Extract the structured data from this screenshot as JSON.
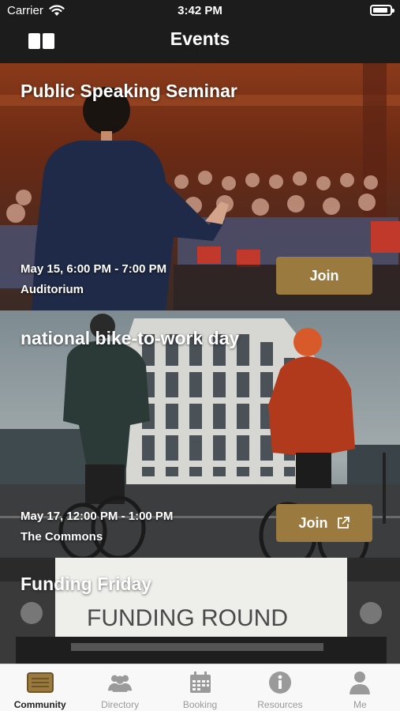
{
  "status_bar": {
    "carrier": "Carrier",
    "time": "3:42 PM"
  },
  "nav": {
    "title": "Events",
    "menu_icon": "sidebar-icon"
  },
  "colors": {
    "accent": "#9a7a3f",
    "nav_bg": "#1c1c1c",
    "tab_active": "#222222",
    "tab_inactive": "#9a9a9a"
  },
  "events": [
    {
      "title": "Public Speaking Seminar",
      "when": "May 15, 6:00 PM - 7:00 PM",
      "where": "Auditorium",
      "button": "Join",
      "external": false
    },
    {
      "title": "national bike-to-work day",
      "when": "May 17, 12:00 PM - 1:00 PM",
      "where": "The Commons",
      "button": "Join",
      "external": true
    },
    {
      "title": "Funding Friday",
      "image_text": "FUNDING ROUND"
    }
  ],
  "tabs": [
    {
      "label": "Community",
      "icon": "community-icon",
      "active": true
    },
    {
      "label": "Directory",
      "icon": "directory-icon",
      "active": false
    },
    {
      "label": "Booking",
      "icon": "calendar-icon",
      "active": false
    },
    {
      "label": "Resources",
      "icon": "info-icon",
      "active": false
    },
    {
      "label": "Me",
      "icon": "person-icon",
      "active": false
    }
  ]
}
